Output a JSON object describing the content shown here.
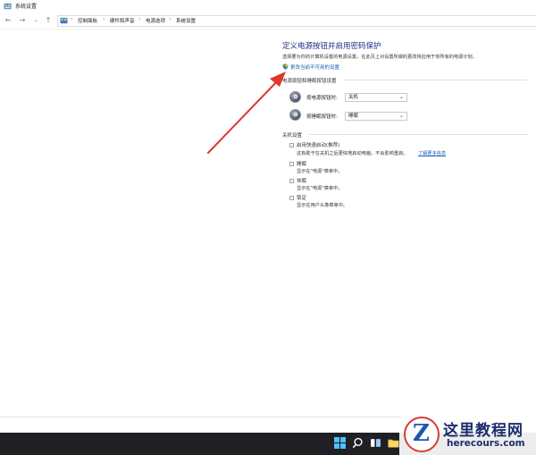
{
  "window": {
    "title": "系统设置"
  },
  "nav": {
    "back": "←",
    "forward": "→",
    "down": "⌄",
    "up": "↑"
  },
  "breadcrumb": {
    "items": [
      "控制面板",
      "硬件和声音",
      "电源选项",
      "系统设置"
    ],
    "sep": "›"
  },
  "main": {
    "title": "定义电源按钮并启用密码保护",
    "description": "选择要为你的计算机设置的电源设置。在此页上对设置所做的更改将应用于你所有的电源计划。",
    "change_link": "更改当前不可用的设置",
    "power_section": {
      "heading": "电源按钮和睡眠按钮设置",
      "rows": [
        {
          "label": "按电源按钮时:",
          "value": "关机"
        },
        {
          "label": "按睡眠按钮时:",
          "value": "睡眠"
        }
      ]
    },
    "shutdown_section": {
      "heading": "关机设置",
      "options": [
        {
          "label": "启用快速启动(推荐)",
          "sub": "这有助于在关机之后更快地启动电脑。不会影响重启。",
          "link": "了解更多信息"
        },
        {
          "label": "睡眠",
          "sub": "显示在\"电源\"菜单中。"
        },
        {
          "label": "休眠",
          "sub": "显示在\"电源\"菜单中。"
        },
        {
          "label": "锁定",
          "sub": "显示在用户头像菜单中。"
        }
      ]
    }
  },
  "watermark": {
    "letter": "Z",
    "title": "这里教程网",
    "url": "herecours.com"
  },
  "colors": {
    "title": "#1e3287",
    "link": "#1a5fb4",
    "arrow": "#e0362c",
    "taskbar": "#1f1f24"
  }
}
